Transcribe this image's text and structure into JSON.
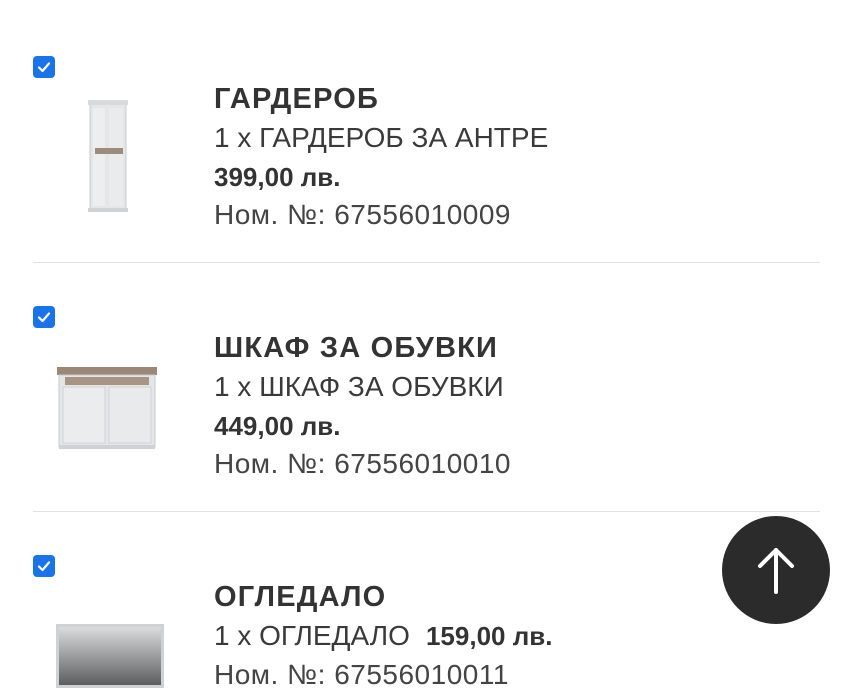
{
  "items": [
    {
      "title": "ГАРДЕРОБ",
      "quantity_line": "1 x ГАРДЕРОБ ЗА АНТРЕ",
      "price": "399,00 лв.",
      "sku": "Ном. №: 67556010009",
      "checked": true
    },
    {
      "title": "ШКАФ ЗА ОБУВКИ",
      "quantity_line": "1 x ШКАФ ЗА ОБУВКИ",
      "price": "449,00 лв.",
      "sku": "Ном. №: 67556010010",
      "checked": true
    },
    {
      "title": "ОГЛЕДАЛО",
      "quantity_line": "1 x ОГЛЕДАЛО",
      "price": "159,00 лв.",
      "sku": "Ном. №: 67556010011",
      "checked": true
    }
  ],
  "scroll_top_button": {
    "icon": "arrow-up-icon"
  },
  "colors": {
    "checkbox": "#1a73e8",
    "fab": "#2b2b2b",
    "divider": "#e2e2e2"
  }
}
